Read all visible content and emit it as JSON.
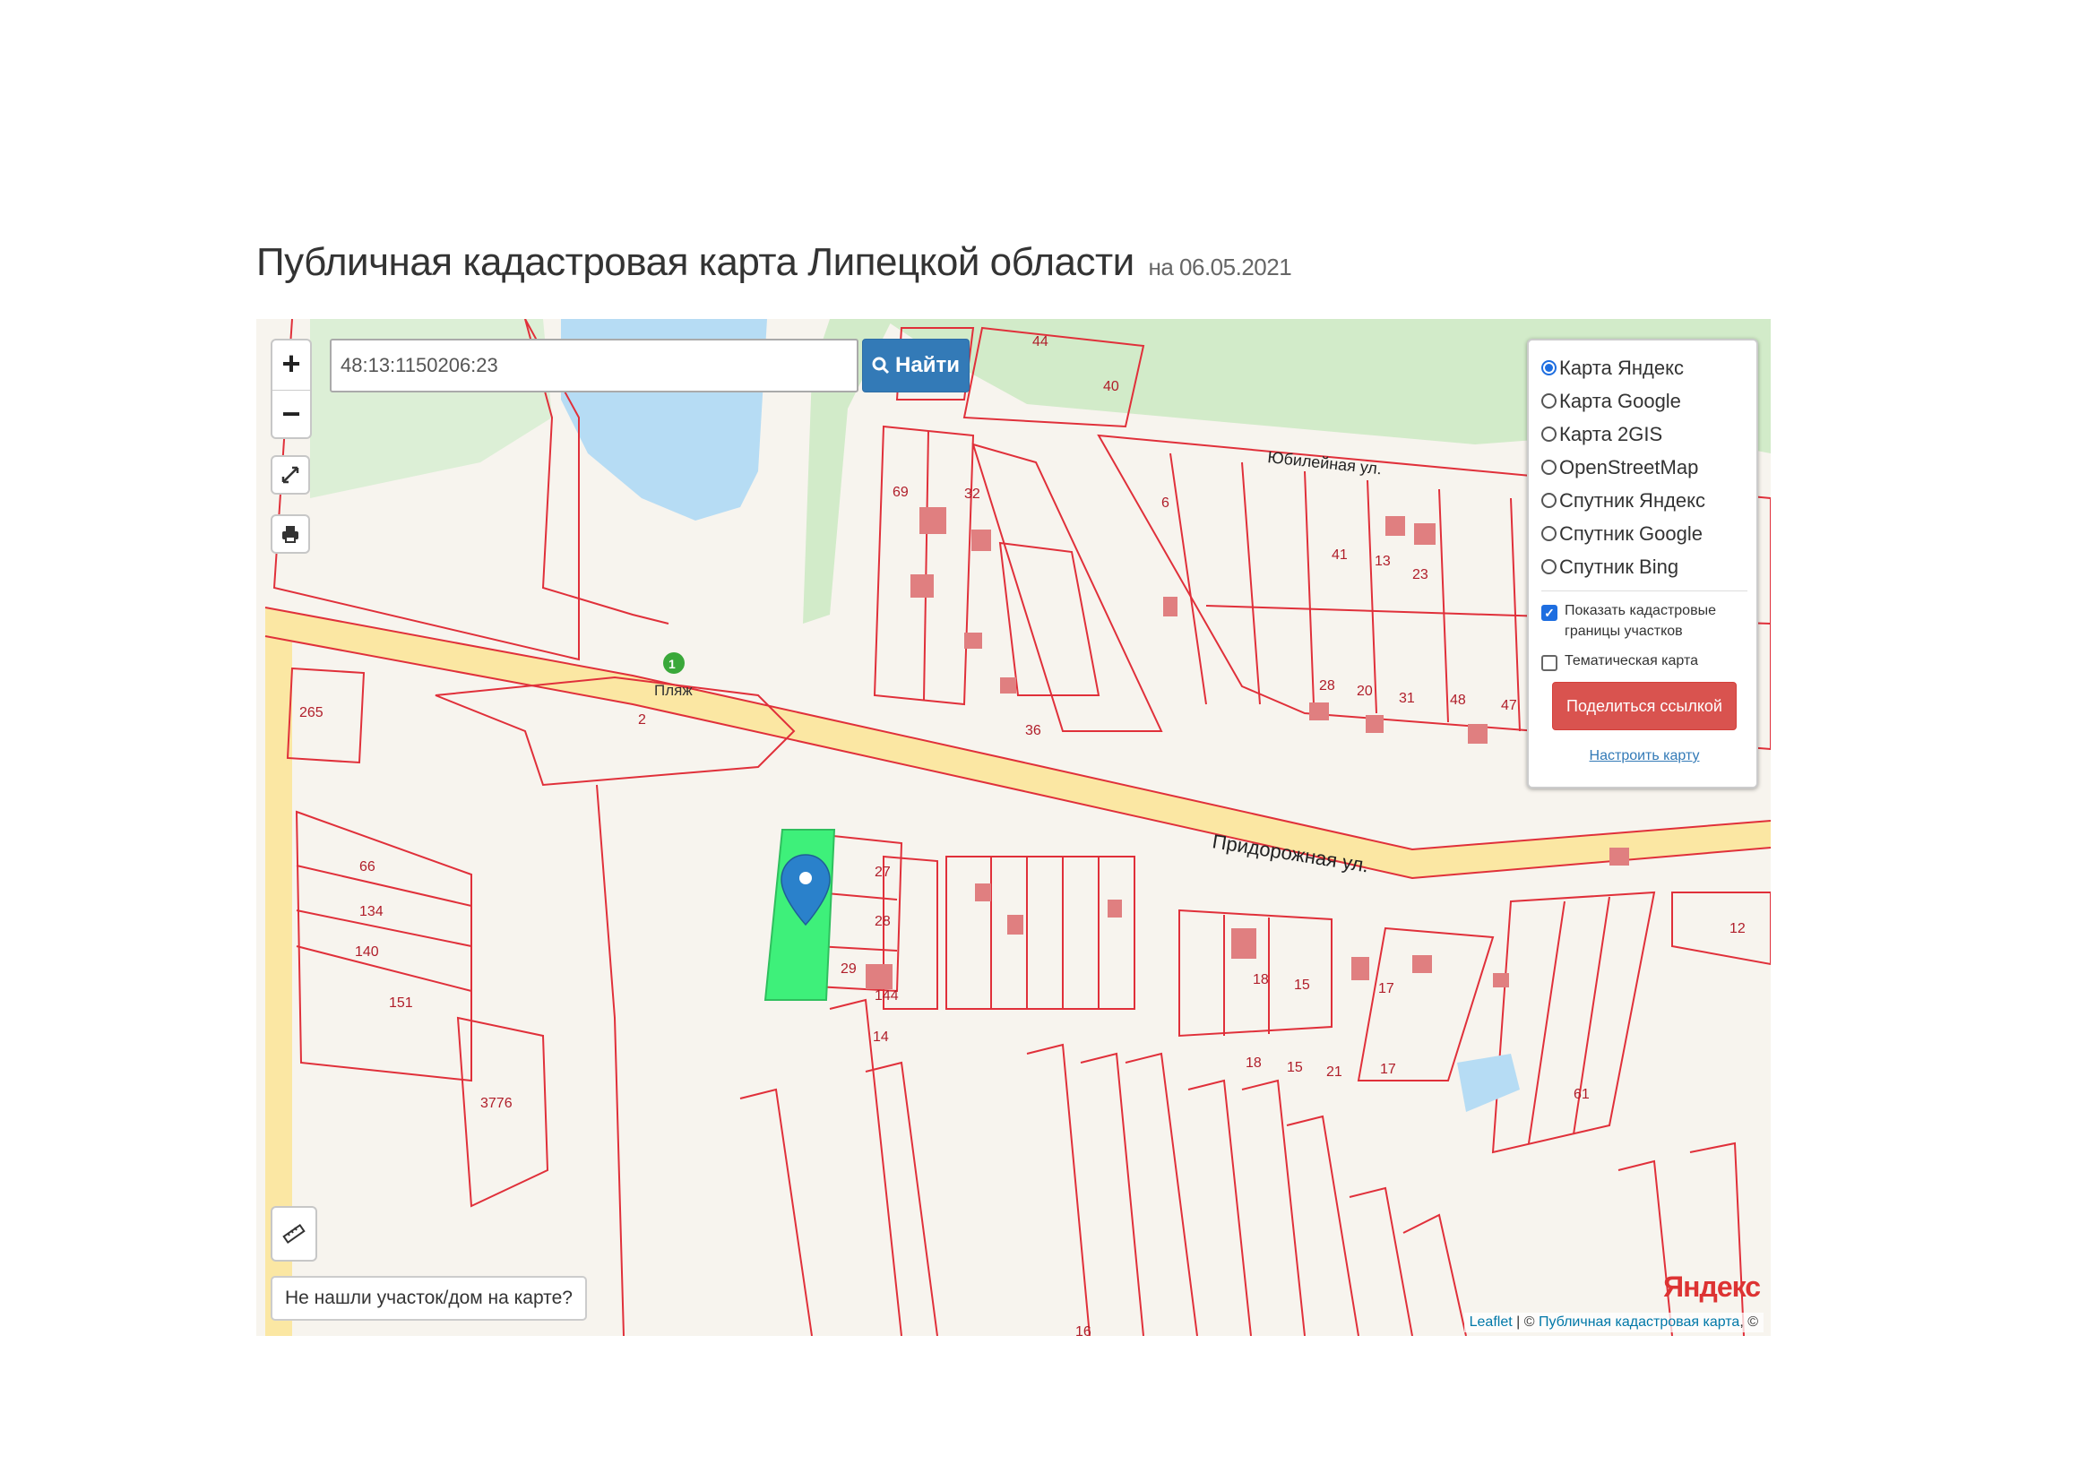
{
  "header": {
    "title": "Публичная кадастровая карта Липецкой области",
    "date": "на 06.05.2021"
  },
  "search": {
    "value": "48:13:1150206:23",
    "button_label": "Найти"
  },
  "zoom": {
    "in_label": "+",
    "out_label": "−"
  },
  "layers": {
    "options": [
      {
        "label": "Карта Яндекс",
        "checked": true
      },
      {
        "label": "Карта Google",
        "checked": false
      },
      {
        "label": "Карта 2GIS",
        "checked": false
      },
      {
        "label": "OpenStreetMap",
        "checked": false
      },
      {
        "label": "Спутник Яндекс",
        "checked": false
      },
      {
        "label": "Спутник Google",
        "checked": false
      },
      {
        "label": "Спутник Bing",
        "checked": false
      }
    ],
    "show_borders_label": "Показать кадастровые границы участков",
    "thematic_label": "Тематическая карта",
    "share_label": "Поделиться ссылкой",
    "configure_label": "Настроить карту"
  },
  "map": {
    "street_main": "Придорожная ул.",
    "street_top": "Юбилейная ул.",
    "beach_label": "Пляж",
    "yandex_logo": "Яндекс"
  },
  "not_found_label": "Не нашли участок/дом на карте?",
  "attribution": {
    "leaflet": "Leaflet",
    "separator": " | © ",
    "cadastral": "Публичная кадастровая карта",
    "tail": ", ©"
  },
  "icons": [
    "zoom-in-icon",
    "zoom-out-icon",
    "fullscreen-icon",
    "print-icon",
    "search-icon",
    "ruler-icon",
    "map-marker-icon",
    "beach-icon"
  ],
  "colors": {
    "parcel_border": "#e0303a",
    "selected_parcel": "#3ef07a",
    "water": "#b6dcf4",
    "forest": "#cfeac7",
    "road": "#fbe7a3",
    "button_blue": "#337ab7",
    "button_red": "#d9534f"
  }
}
